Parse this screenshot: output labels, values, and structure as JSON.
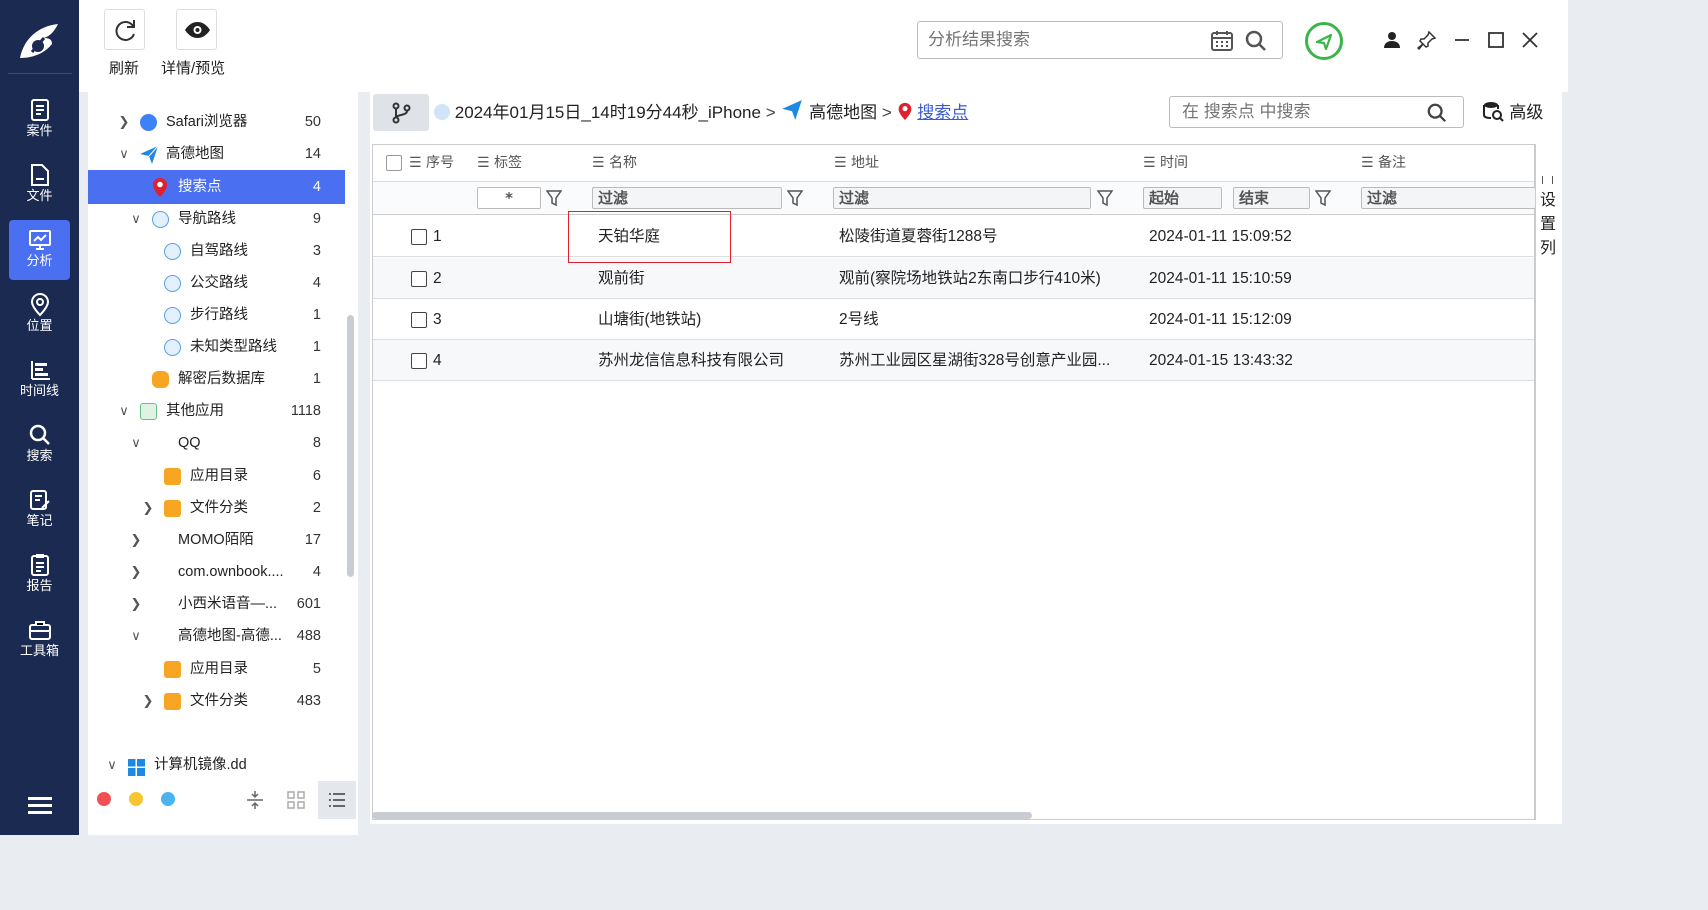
{
  "toolbar": {
    "refresh_label": "刷新",
    "details_label": "详情/预览",
    "search_placeholder": "分析结果搜索"
  },
  "nav": {
    "items": [
      {
        "label": "案件"
      },
      {
        "label": "文件"
      },
      {
        "label": "分析"
      },
      {
        "label": "位置"
      },
      {
        "label": "时间线"
      },
      {
        "label": "搜索"
      },
      {
        "label": "笔记"
      },
      {
        "label": "报告"
      },
      {
        "label": "工具箱"
      }
    ],
    "active": "分析"
  },
  "tree": [
    {
      "label": "Safari浏览器",
      "count": "50"
    },
    {
      "label": "高德地图",
      "count": "14"
    },
    {
      "label": "搜索点",
      "count": "4"
    },
    {
      "label": "导航路线",
      "count": "9"
    },
    {
      "label": "自驾路线",
      "count": "3"
    },
    {
      "label": "公交路线",
      "count": "4"
    },
    {
      "label": "步行路线",
      "count": "1"
    },
    {
      "label": "未知类型路线",
      "count": "1"
    },
    {
      "label": "解密后数据库",
      "count": "1"
    },
    {
      "label": "其他应用",
      "count": "1118"
    },
    {
      "label": "QQ",
      "count": "8"
    },
    {
      "label": "应用目录",
      "count": "6"
    },
    {
      "label": "文件分类",
      "count": "2"
    },
    {
      "label": "MOMO陌陌",
      "count": "17"
    },
    {
      "label": "com.ownbook....",
      "count": "4"
    },
    {
      "label": "小西米语音—...",
      "count": "601"
    },
    {
      "label": "高德地图-高德...",
      "count": "488"
    },
    {
      "label": "应用目录",
      "count": "5"
    },
    {
      "label": "文件分类",
      "count": "483"
    },
    {
      "label": "计算机镜像.dd",
      "count": ""
    }
  ],
  "breadcrumb": {
    "device": "2024年01月15日_14时19分44秒_iPhone",
    "app": "高德地图",
    "current": "搜索点"
  },
  "table_search": {
    "placeholder": "在 搜索点 中搜索"
  },
  "advanced_label": "高级",
  "columns": {
    "index": "序号",
    "tag": "标签",
    "name": "名称",
    "address": "地址",
    "time": "时间",
    "note": "备注"
  },
  "filters": {
    "tag": "*",
    "name": "过滤",
    "address": "过滤",
    "time_start": "起始",
    "time_end": "结束",
    "note": "过滤"
  },
  "rows": [
    {
      "index": "1",
      "name": "天铂华庭",
      "address": "松陵街道夏蓉街1288号",
      "time": "2024-01-11 15:09:52"
    },
    {
      "index": "2",
      "name": "观前街",
      "address": "观前(察院场地铁站2东南口步行410米)",
      "time": "2024-01-11 15:10:59"
    },
    {
      "index": "3",
      "name": "山塘街(地铁站)",
      "address": "2号线",
      "time": "2024-01-11 15:12:09"
    },
    {
      "index": "4",
      "name": "苏州龙信信息科技有限公司",
      "address": "苏州工业园区星湖街328号创意产业园...",
      "time": "2024-01-15 13:43:32"
    }
  ],
  "settings_col": "设置列",
  "colors": {
    "nav_bg": "#1b2a50",
    "accent": "#4a6ff0",
    "highlight": "#e0202c",
    "status_green": "#3bb54a"
  }
}
